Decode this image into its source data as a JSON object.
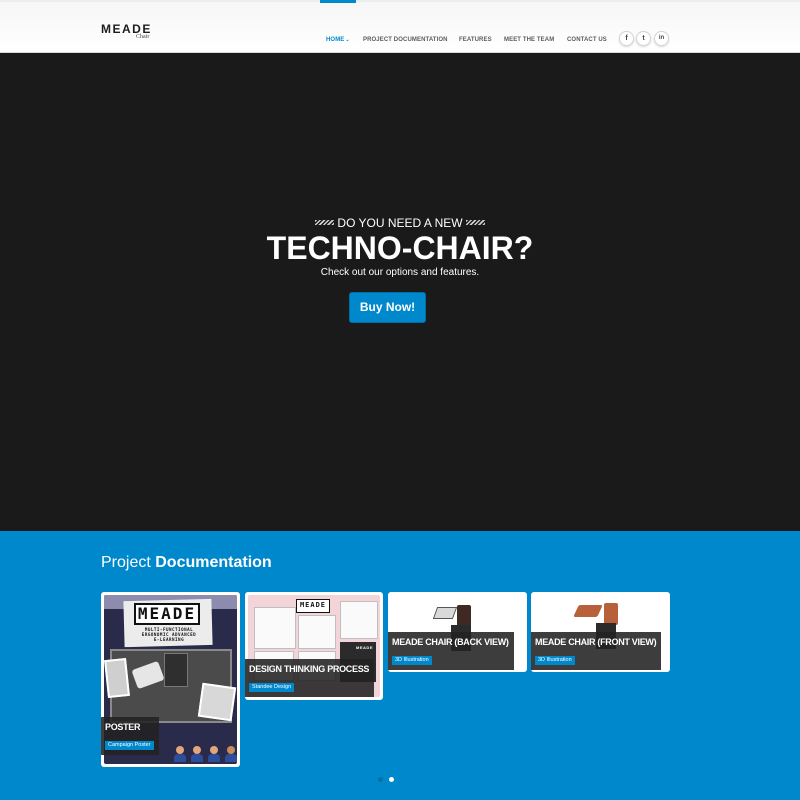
{
  "header": {
    "logo_main": "MEADE",
    "logo_sub": "Chair",
    "nav": [
      {
        "label": "HOME",
        "active": true,
        "has_caret": true
      },
      {
        "label": "PROJECT DOCUMENTATION",
        "active": false
      },
      {
        "label": "FEATURES",
        "active": false
      },
      {
        "label": "MEET THE TEAM",
        "active": false
      },
      {
        "label": "CONTACT US",
        "active": false
      }
    ],
    "caret_glyph": "⌄",
    "social": [
      {
        "icon": "facebook-icon",
        "glyph": "f"
      },
      {
        "icon": "twitter-icon",
        "glyph": "t"
      },
      {
        "icon": "linkedin-icon",
        "glyph": "in"
      }
    ]
  },
  "hero": {
    "kicker": "DO YOU NEED A NEW",
    "title": "TECHNO-CHAIR?",
    "subtitle": "Check out our options and features.",
    "button": "Buy Now!"
  },
  "projects": {
    "title_light": "Project",
    "title_bold": "Documentation",
    "cards": [
      {
        "title": "POSTER",
        "tag": "Campaign Poster"
      },
      {
        "title": "DESIGN THINKING PROCESS",
        "tag": "Standee Design"
      },
      {
        "title": "MEADE CHAIR (BACK VIEW)",
        "tag": "3D Illustration"
      },
      {
        "title": "MEADE CHAIR (FRONT VIEW)",
        "tag": "3D Illustration"
      }
    ],
    "poster_art": {
      "logo": "MEADE",
      "lines": [
        "MULTI-FUNCTIONAL",
        "ERGONOMIC ADVANCED",
        "E-LEARNING"
      ]
    },
    "standee_art": {
      "logo": "MEADE",
      "corner_label": "MEADE"
    },
    "pager": {
      "count": 2,
      "active_index": 1
    }
  },
  "colors": {
    "accent": "#0088cc",
    "hero_bg": "#1a1a1a",
    "header_bg": "#ffffff",
    "overlay_bg": "#222222"
  }
}
